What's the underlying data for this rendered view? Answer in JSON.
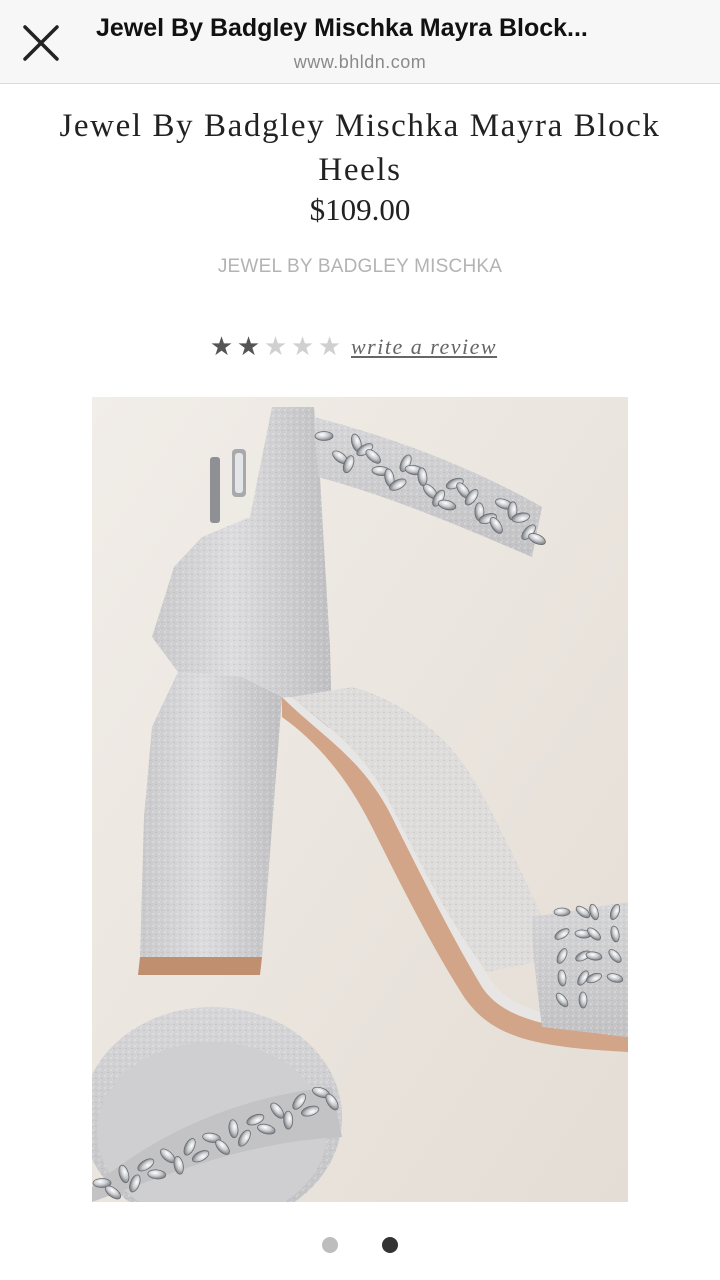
{
  "browser": {
    "title": "Jewel By Badgley Mischka Mayra Block...",
    "url": "www.bhldn.com",
    "close_icon": "close-x-icon"
  },
  "product": {
    "title": "Jewel By Badgley Mischka Mayra Block Heels",
    "price": "$109.00",
    "brand": "JEWEL BY BADGLEY MISCHKA",
    "rating": {
      "value": 2,
      "max": 5
    },
    "review_link": "write a review",
    "image": {
      "subject": "silver glitter block heel sandal with embellished ankle strap"
    }
  },
  "carousel": {
    "total": 2,
    "active_index": 1
  },
  "colors": {
    "star_filled": "#555555",
    "star_empty": "#d0d0d0",
    "dot_active": "#333333",
    "dot_inactive": "#bdbdbd"
  }
}
